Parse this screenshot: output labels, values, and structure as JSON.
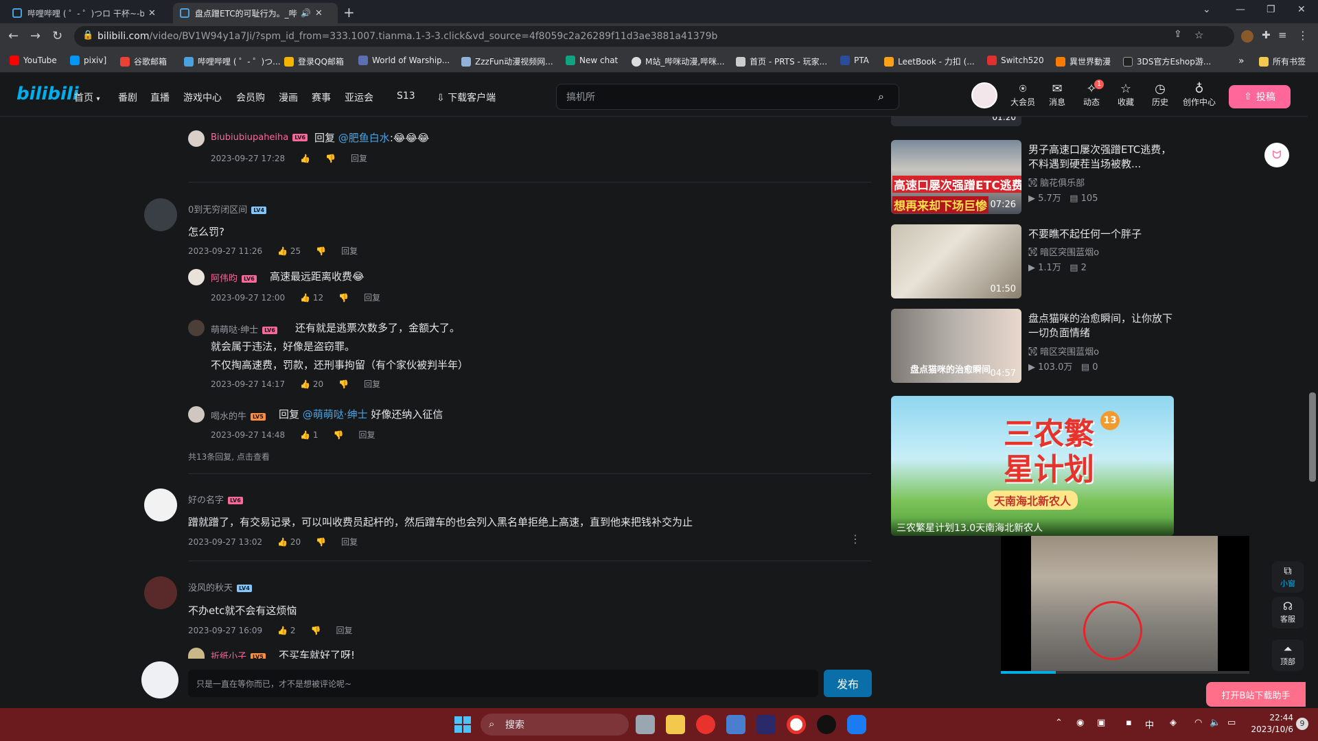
{
  "browser": {
    "tabs": [
      {
        "title": "哔哩哔哩 ( ゜- ゜)つロ 干杯~-bili",
        "active": false
      },
      {
        "title": "盘点蹭ETC的可耻行为。_哔",
        "active": true
      }
    ],
    "new_tab": "+",
    "url_main": "bilibili.com",
    "url_rest": "/video/BV1W94y1a7Ji/?spm_id_from=333.1007.tianma.1-3-3.click&vd_source=4f8059c2a26289f11d3ae3881a41379b",
    "bookmarks": [
      {
        "label": "YouTube",
        "color": "#ff0000"
      },
      {
        "label": "pixiv]",
        "color": "#0096fa"
      },
      {
        "label": "谷歌邮箱",
        "color": "#ea4335"
      },
      {
        "label": "哔哩哔哩 ( ゜- ゜)つ...",
        "color": "#4aa3e0"
      },
      {
        "label": "登录QQ邮箱",
        "color": "#f5b400"
      },
      {
        "label": "World of Warship...",
        "color": "#5b6fb5"
      },
      {
        "label": "ZzzFun动漫视频网...",
        "color": "#8fb3d9"
      },
      {
        "label": "New chat",
        "color": "#10a37f"
      },
      {
        "label": "M站_哔咪动漫,哔咪...",
        "color": "#dddddd"
      },
      {
        "label": "首页 - PRTS - 玩家...",
        "color": "#cccccc"
      },
      {
        "label": "PTA",
        "color": "#2a4d9b"
      },
      {
        "label": "LeetBook - 力扣 (...",
        "color": "#ffa116"
      },
      {
        "label": "Switch520",
        "color": "#e03030"
      },
      {
        "label": "異世界動漫",
        "color": "#ff7a00"
      },
      {
        "label": "3DS官方Eshop游...",
        "color": "#222222"
      }
    ],
    "bookmarks_more": "»",
    "all_bookmarks": "所有书签"
  },
  "header": {
    "logo": "bilibili",
    "nav": [
      "首页",
      "番剧",
      "直播",
      "游戏中心",
      "会员购",
      "漫画",
      "赛事",
      "亚运会",
      "S13",
      "下载客户端"
    ],
    "search_placeholder": "搞机所",
    "icons": [
      {
        "label": "大会员",
        "icon": "vip-icon"
      },
      {
        "label": "消息",
        "icon": "message-icon"
      },
      {
        "label": "动态",
        "icon": "dynamic-icon",
        "badge": "1"
      },
      {
        "label": "收藏",
        "icon": "favorite-icon"
      },
      {
        "label": "历史",
        "icon": "history-icon"
      },
      {
        "label": "创作中心",
        "icon": "creator-icon"
      }
    ],
    "upload": "投稿"
  },
  "comments": [
    {
      "user": "Biubiubiupaheiha",
      "level": "LV6",
      "reply_to": "@肥鱼白水",
      "text": "回复",
      "text_after": ":😂😂😂",
      "date": "2023-09-27 17:28",
      "likes": "",
      "reply": "回复"
    },
    {
      "user": "0到无穷闭区间",
      "level": "LV4",
      "text": "怎么罚?",
      "date": "2023-09-27 11:26",
      "likes": "25",
      "reply": "回复"
    },
    {
      "user": "阿伟昀",
      "level": "LV6",
      "text": "高速最远距离收费😂",
      "date": "2023-09-27 12:00",
      "likes": "12",
      "reply": "回复"
    },
    {
      "user": "萌萌哒·绅士",
      "level": "LV6",
      "lines": [
        "还有就是逃票次数多了，金额大了。",
        "就会属于违法，好像是盗窃罪。",
        "不仅掏高速费，罚款，还刑事拘留（有个家伙被判半年）"
      ],
      "date": "2023-09-27 14:17",
      "likes": "20",
      "reply": "回复"
    },
    {
      "user": "喝水的牛",
      "level": "LV5",
      "reply_to": "@萌萌哒·绅士",
      "text": "回复",
      "text_after": "好像还纳入征信",
      "date": "2023-09-27 14:48",
      "likes": "1",
      "reply": "回复"
    },
    {
      "more": "共13条回复, 点击查看"
    },
    {
      "user": "好の名字",
      "level": "LV6",
      "text": "蹭就蹭了，有交易记录，可以叫收费员起杆的，然后蹭车的也会列入黑名单拒绝上高速，直到他来把钱补交为止",
      "date": "2023-09-27 13:02",
      "likes": "20",
      "reply": "回复"
    },
    {
      "user": "没风的秋天",
      "level": "LV4",
      "text": "不办etc就不会有这烦恼",
      "date": "2023-09-27 16:09",
      "likes": "2",
      "reply": "回复"
    },
    {
      "user": "折纸小子",
      "level": "LV5",
      "text": "不买车就好了呀!"
    }
  ],
  "comment_box": {
    "placeholder": "只是一直在等你而已，才不是想被评论呢~",
    "submit": "发布"
  },
  "related": [
    {
      "title": "男子高速口屡次强蹭ETC逃费，不料遇到硬茬当场被教...",
      "up": "脑花俱乐部",
      "views": "5.7万",
      "danmaku": "105",
      "duration": "07:26",
      "thumb_caption1": "高速口屡次强蹭ETC逃费",
      "thumb_caption2": "想再来却下场巨惨"
    },
    {
      "title": "不要瞧不起任何一个胖子",
      "up": "暗区突围蓝烟o",
      "views": "1.1万",
      "danmaku": "2",
      "duration": "01:50"
    },
    {
      "title": "盘点猫咪的治愈瞬间，让你放下一切负面情绪",
      "up": "暗区突围蓝烟o",
      "views": "103.0万",
      "danmaku": "0",
      "duration": "04:57",
      "thumb_caption1": "盘点猫咪的治愈瞬间"
    }
  ],
  "top_partial_duration": "01:20",
  "ad": {
    "title_main": "三农繁星计划",
    "number": "13",
    "subtitle": "天南海北新农人",
    "caption": "三农繁星计划13.0天南海北新农人"
  },
  "side_buttons": [
    {
      "label": "小窗",
      "icon": "mini-window-icon"
    },
    {
      "label": "客服",
      "icon": "headset-icon"
    },
    {
      "label": "顶部",
      "icon": "to-top-icon"
    }
  ],
  "download_helper": "打开B站下载助手",
  "taskbar": {
    "search": "搜索",
    "tray_lang": "中",
    "time": "22:44",
    "date": "2023/10/6",
    "notif": "9"
  },
  "colors": {
    "accent": "#ff6699",
    "link": "#4aa3e0",
    "taskbar": "#6b1a1e",
    "lv6": "#ff6699",
    "lv4": "#80c8ff",
    "lv5": "#ff8f3e"
  }
}
